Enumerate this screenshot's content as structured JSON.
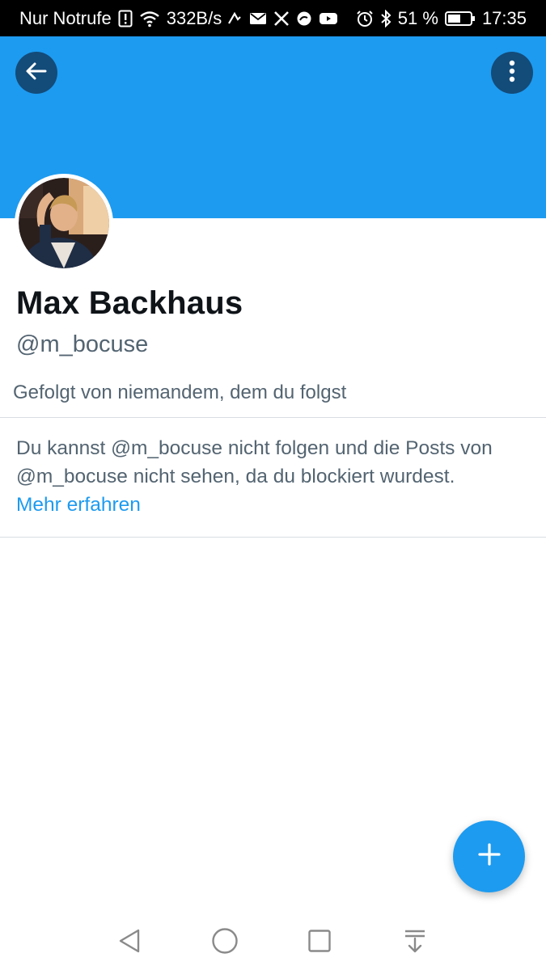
{
  "status_bar": {
    "carrier": "Nur Notrufe",
    "speed": "332B/s",
    "battery": "51 %",
    "time": "17:35",
    "icons_left": [
      "alert-icon",
      "wifi-icon"
    ],
    "icons_right": [
      "app-icon",
      "mail-icon",
      "x-icon",
      "edge-icon",
      "youtube-icon",
      "alarm-icon",
      "bluetooth-icon",
      "battery-icon"
    ]
  },
  "banner": {
    "color": "#1d9bf0"
  },
  "profile": {
    "name": "Max Backhaus",
    "handle": "@m_bocuse",
    "followed_by": "Gefolgt von niemandem, dem du folgst"
  },
  "blocked_notice": {
    "line1": "Du kannst @m_bocuse nicht folgen und die Posts von",
    "line2": "@m_bocuse nicht sehen, da du blockiert wurdest.",
    "link": "Mehr erfahren"
  },
  "fab": {
    "icon": "plus-icon"
  },
  "nav_bar": {
    "icons": [
      "back-triangle-icon",
      "home-circle-icon",
      "recents-square-icon",
      "notification-pull-icon"
    ]
  },
  "colors": {
    "accent": "#1d9bf0",
    "text_primary": "#0f1419",
    "text_secondary": "#536471",
    "divider": "#d9dde1"
  }
}
